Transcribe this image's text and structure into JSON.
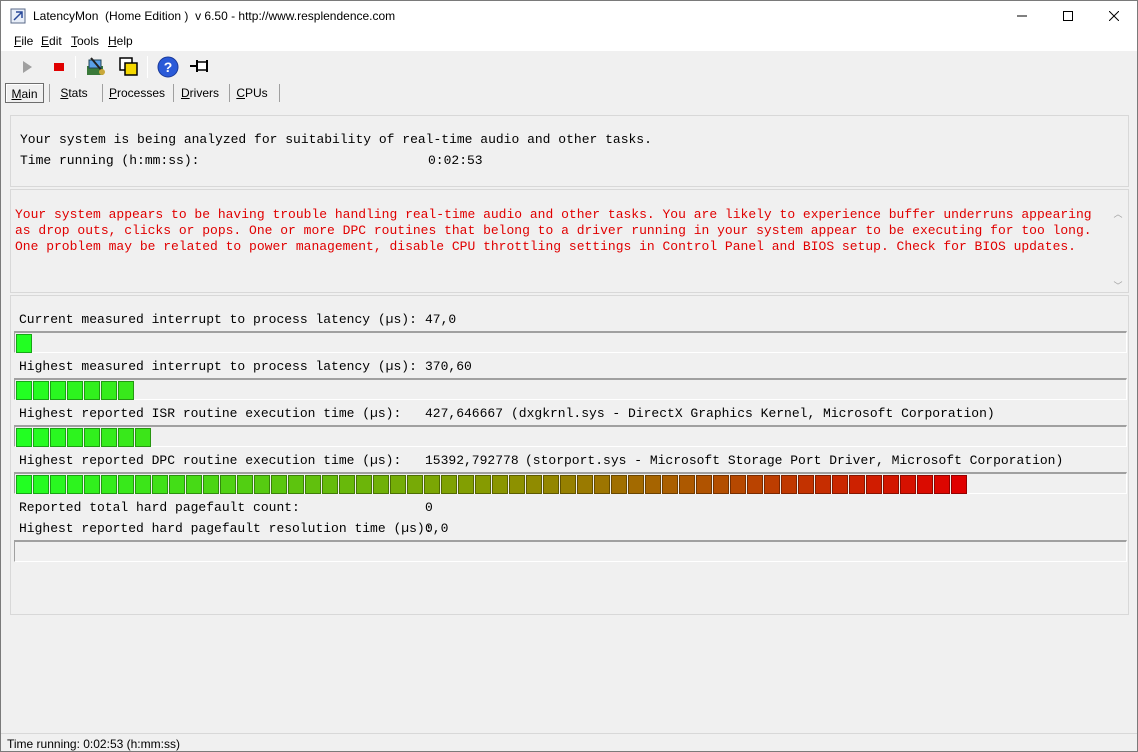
{
  "window": {
    "title": "LatencyMon  (Home Edition )  v 6.50 - http://www.resplendence.com"
  },
  "menu": [
    {
      "prefix": "",
      "u": "F",
      "rest": "ile"
    },
    {
      "prefix": "",
      "u": "E",
      "rest": "dit"
    },
    {
      "prefix": "",
      "u": "T",
      "rest": "ools"
    },
    {
      "prefix": "",
      "u": "H",
      "rest": "elp"
    }
  ],
  "toolbar": {
    "icons": [
      "play-icon",
      "stop-icon",
      "wizard-icon",
      "windows-icon",
      "help-icon",
      "pin-icon"
    ]
  },
  "tabs": [
    {
      "u": "M",
      "rest": "ain",
      "active": true
    },
    {
      "u": "S",
      "rest": "tats",
      "active": false
    },
    {
      "u": "P",
      "rest": "rocesses",
      "active": false
    },
    {
      "u": "D",
      "rest": "rivers",
      "active": false
    },
    {
      "u": "C",
      "rest": "PUs",
      "active": false
    }
  ],
  "summary": {
    "line1": "Your system is being analyzed for suitability of real-time audio and other tasks.",
    "time_label": "Time running (h:mm:ss):",
    "time_value": "0:02:53"
  },
  "warning": {
    "text": "Your system appears to be having trouble handling real-time audio and other tasks. You are likely to experience buffer underruns appearing as drop outs, clicks or pops. One or more DPC routines that belong to a driver running in your system appear to be executing for too long. One problem may be related to power management, disable CPU throttling settings in Control Panel and BIOS setup. Check for BIOS updates."
  },
  "metrics": {
    "current": {
      "label": "Current measured interrupt to process latency (µs):",
      "value": "47,0",
      "detail": "",
      "segments": 1
    },
    "highest": {
      "label": "Highest measured interrupt to process latency (µs):",
      "value": "370,60",
      "detail": "",
      "segments": 7
    },
    "isr": {
      "label": "Highest reported ISR routine execution time (µs):",
      "value": "427,646667",
      "detail": "(dxgkrnl.sys - DirectX Graphics Kernel, Microsoft Corporation)",
      "segments": 8
    },
    "dpc": {
      "label": "Highest reported DPC routine execution time (µs):",
      "value": "15392,792778",
      "detail": "(storport.sys - Microsoft Storage Port Driver, Microsoft Corporation)",
      "segments": 56
    },
    "pf_count": {
      "label": "Reported total hard pagefault count:",
      "value": "0"
    },
    "pf_time": {
      "label": "Highest reported hard pagefault resolution time (µs):",
      "value": "0,0",
      "segments": 0
    }
  },
  "colors": {
    "green": "#22e822",
    "red": "#e00000"
  },
  "status": {
    "text": "Time running: 0:02:53  (h:mm:ss)"
  }
}
